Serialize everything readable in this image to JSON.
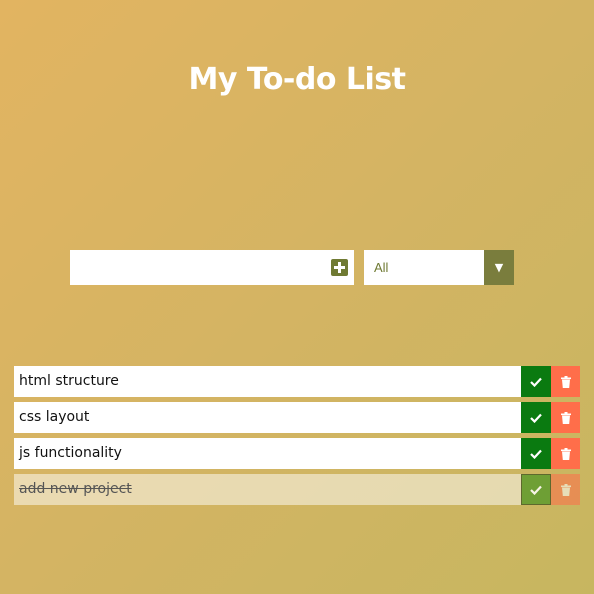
{
  "app": {
    "title": "My To-do List"
  },
  "new_todo": {
    "value": "",
    "placeholder": "",
    "add_icon": "plus-square-icon"
  },
  "filter": {
    "selected": "All",
    "arrow_icon": "caret-down-icon"
  },
  "todos": [
    {
      "text": "html structure",
      "completed": false
    },
    {
      "text": "css layout",
      "completed": false
    },
    {
      "text": "js functionality",
      "completed": false
    },
    {
      "text": "add new project",
      "completed": true
    }
  ],
  "colors": {
    "accent": "#6f7a33",
    "complete_button": "#0a7a10",
    "delete_button": "#ff6e4a"
  }
}
